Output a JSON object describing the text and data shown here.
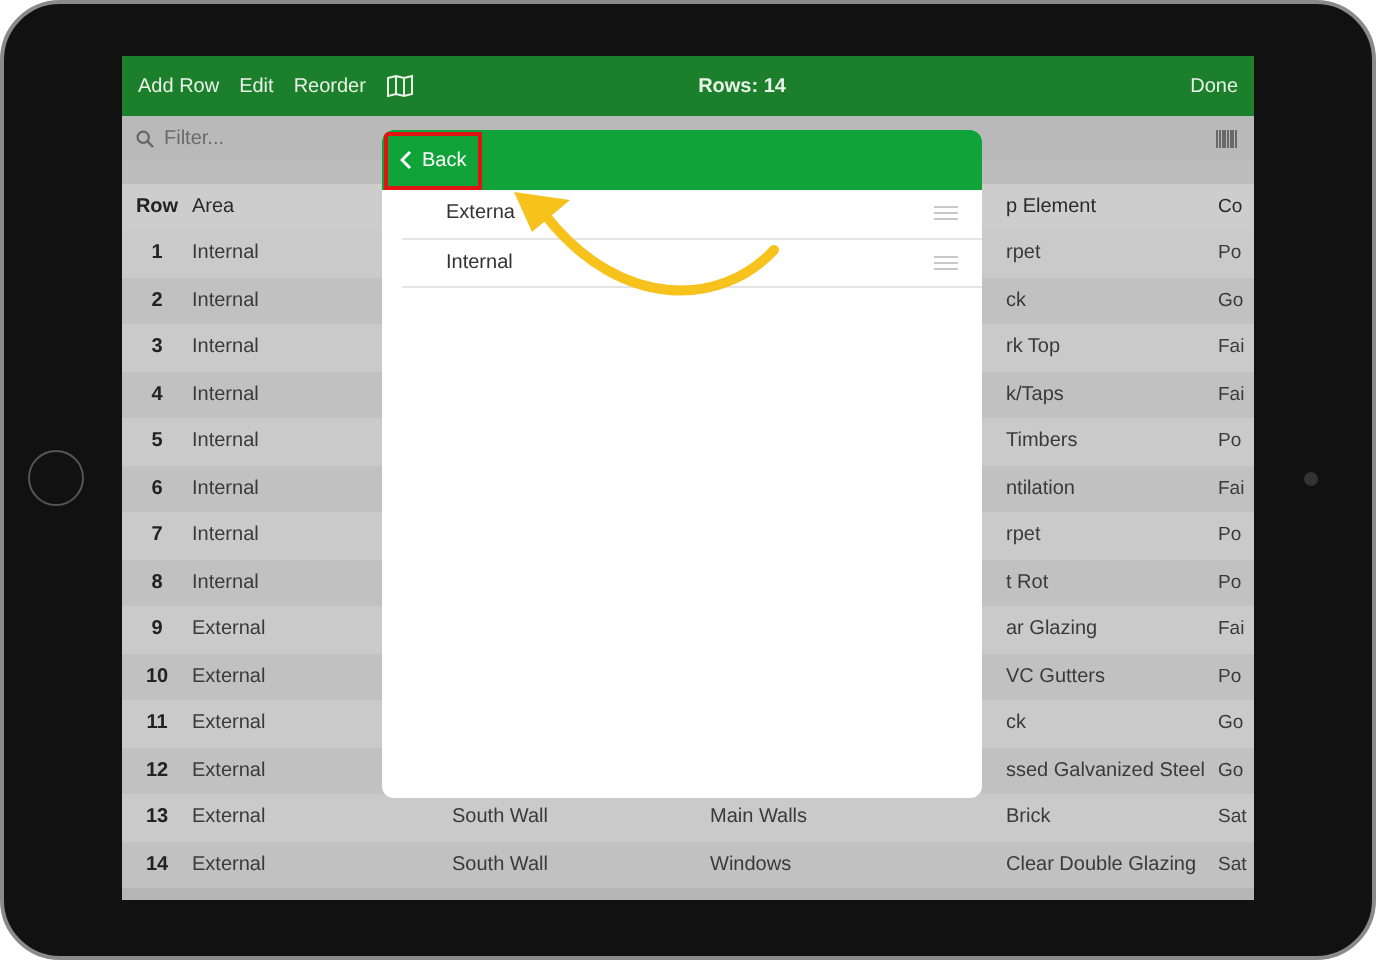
{
  "toolbar": {
    "buttons": [
      "Add Row",
      "Edit",
      "Reorder"
    ],
    "title": "Rows: 14",
    "done": "Done"
  },
  "filter": {
    "placeholder": "Filter..."
  },
  "table": {
    "header": {
      "row": "Row",
      "area": "Area",
      "column_5": "p Element",
      "column_6": "Co"
    },
    "rows": [
      {
        "row": "1",
        "area": "Internal",
        "column_5": "rpet",
        "column_6": "Po"
      },
      {
        "row": "2",
        "area": "Internal",
        "column_5": "ck",
        "column_6": "Go"
      },
      {
        "row": "3",
        "area": "Internal",
        "column_5": "rk Top",
        "column_6": "Fai"
      },
      {
        "row": "4",
        "area": "Internal",
        "column_5": "k/Taps",
        "column_6": "Fai"
      },
      {
        "row": "5",
        "area": "Internal",
        "column_5": "Timbers",
        "column_6": "Po"
      },
      {
        "row": "6",
        "area": "Internal",
        "column_5": "ntilation",
        "column_6": "Fai"
      },
      {
        "row": "7",
        "area": "Internal",
        "column_5": "rpet",
        "column_6": "Po"
      },
      {
        "row": "8",
        "area": "Internal",
        "column_5": "t Rot",
        "column_6": "Po"
      },
      {
        "row": "9",
        "area": "External",
        "column_5": "ar Glazing",
        "column_6": "Fai"
      },
      {
        "row": "10",
        "area": "External",
        "column_5": "VC Gutters",
        "column_6": "Po"
      },
      {
        "row": "11",
        "area": "External",
        "column_5": "ck",
        "column_6": "Go"
      },
      {
        "row": "12",
        "area": "External",
        "column_5": "ssed Galvanized Steel",
        "column_6": "Go"
      },
      {
        "row": "13",
        "area": "External",
        "column_3": "South Wall",
        "column_4": "Main Walls",
        "column_5": "Brick",
        "column_6": "Sat"
      },
      {
        "row": "14",
        "area": "External",
        "column_3": "South Wall",
        "column_4": "Windows",
        "column_5": "Clear Double Glazing",
        "column_6": "Sat"
      }
    ]
  },
  "popover": {
    "back": "Back",
    "items": [
      {
        "label": "Externa"
      },
      {
        "label": "Internal"
      }
    ]
  }
}
